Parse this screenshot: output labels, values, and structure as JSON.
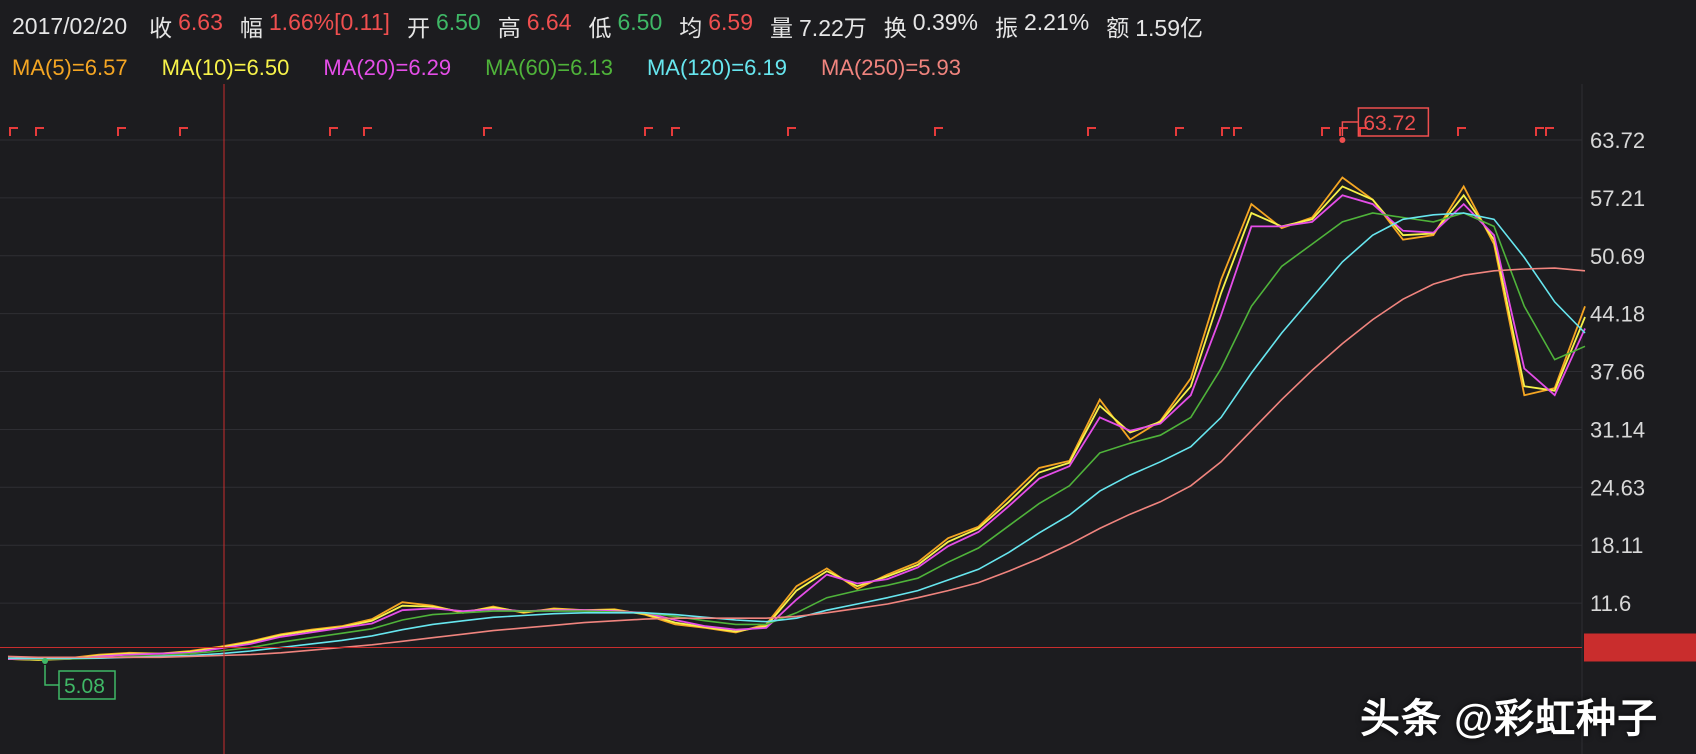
{
  "header": {
    "date": "2017/02/20",
    "items": [
      {
        "label": "收",
        "value": "6.63",
        "color": "red"
      },
      {
        "label": "幅",
        "value": "1.66%[0.11]",
        "color": "red"
      },
      {
        "label": "开",
        "value": "6.50",
        "color": "green"
      },
      {
        "label": "高",
        "value": "6.64",
        "color": "red"
      },
      {
        "label": "低",
        "value": "6.50",
        "color": "green"
      },
      {
        "label": "均",
        "value": "6.59",
        "color": "red"
      },
      {
        "label": "量",
        "value": "7.22万",
        "color": "white"
      },
      {
        "label": "换",
        "value": "0.39%",
        "color": "white"
      },
      {
        "label": "振",
        "value": "2.21%",
        "color": "white"
      },
      {
        "label": "额",
        "value": "1.59亿",
        "color": "white"
      }
    ]
  },
  "ma_legend": [
    {
      "text": "MA(5)=6.57",
      "color": "#f5a623"
    },
    {
      "text": "MA(10)=6.50",
      "color": "#f7f24a"
    },
    {
      "text": "MA(20)=6.29",
      "color": "#e54ee8"
    },
    {
      "text": "MA(60)=6.13",
      "color": "#4fb33a"
    },
    {
      "text": "MA(120)=6.19",
      "color": "#67e6ef"
    },
    {
      "text": "MA(250)=5.93",
      "color": "#f0847e"
    }
  ],
  "watermark": "头条 @彩虹种子",
  "chart_data": {
    "type": "line",
    "y_tick_labels": [
      "63.72",
      "57.21",
      "50.69",
      "44.18",
      "37.66",
      "31.14",
      "24.63",
      "18.11",
      "11.6"
    ],
    "ylim": [
      5.08,
      63.72
    ],
    "x": [
      0,
      30,
      60,
      90,
      120,
      150,
      180,
      210,
      240,
      270,
      300,
      330,
      360,
      390,
      420,
      450,
      480,
      510,
      540,
      570,
      600,
      630,
      660,
      690,
      720,
      750,
      780,
      810,
      840,
      870,
      900,
      930,
      960,
      990,
      1020,
      1050,
      1080,
      1110,
      1140,
      1170,
      1200,
      1230,
      1260,
      1290,
      1320,
      1350,
      1380,
      1410,
      1440,
      1470,
      1500,
      1530,
      1560
    ],
    "max_label": "63.72",
    "min_label": "5.08",
    "crosshair_price": "6.6",
    "series": [
      {
        "name": "MA(5)",
        "color": "#f5a623",
        "values": [
          5.3,
          5.2,
          5.4,
          5.8,
          6.0,
          5.9,
          6.2,
          6.7,
          7.3,
          8.1,
          8.6,
          9.0,
          9.8,
          11.7,
          11.3,
          10.5,
          11.2,
          10.5,
          11.0,
          10.8,
          10.9,
          10.3,
          9.2,
          8.8,
          8.3,
          9.2,
          13.5,
          15.5,
          13.2,
          14.8,
          16.2,
          18.9,
          20.2,
          23.5,
          26.8,
          27.6,
          34.5,
          30.0,
          32.1,
          36.9,
          48.0,
          56.5,
          53.8,
          55.0,
          59.5,
          57.0,
          52.5,
          53.0,
          58.5,
          52.0,
          35.0,
          35.8,
          45.0
        ]
      },
      {
        "name": "MA(10)",
        "color": "#f7f24a",
        "values": [
          5.3,
          5.2,
          5.3,
          5.7,
          5.9,
          5.9,
          6.1,
          6.6,
          7.2,
          8.0,
          8.5,
          8.9,
          9.6,
          11.3,
          11.2,
          10.6,
          11.1,
          10.6,
          10.9,
          10.8,
          10.8,
          10.4,
          9.4,
          8.9,
          8.4,
          9.0,
          13.0,
          15.2,
          13.5,
          14.6,
          15.9,
          18.5,
          20.0,
          23.0,
          26.3,
          27.4,
          33.8,
          30.8,
          32.0,
          36.0,
          46.5,
          55.5,
          54.0,
          54.8,
          58.5,
          57.0,
          53.0,
          53.2,
          57.5,
          52.5,
          36.0,
          35.5,
          43.8
        ]
      },
      {
        "name": "MA(20)",
        "color": "#e54ee8",
        "values": [
          5.3,
          5.3,
          5.3,
          5.6,
          5.8,
          5.9,
          6.0,
          6.5,
          7.0,
          7.8,
          8.3,
          8.8,
          9.3,
          10.8,
          11.0,
          10.7,
          10.9,
          10.7,
          10.8,
          10.8,
          10.7,
          10.5,
          9.7,
          9.0,
          8.6,
          8.8,
          12.0,
          14.8,
          13.8,
          14.3,
          15.6,
          18.0,
          19.6,
          22.5,
          25.6,
          27.0,
          32.5,
          31.0,
          31.8,
          35.0,
          44.0,
          54.0,
          54.0,
          54.5,
          57.5,
          56.5,
          53.5,
          53.3,
          56.5,
          53.0,
          38.0,
          35.0,
          42.5
        ]
      },
      {
        "name": "MA(60)",
        "color": "#4fb33a",
        "values": [
          5.4,
          5.3,
          5.3,
          5.4,
          5.6,
          5.7,
          5.9,
          6.2,
          6.6,
          7.2,
          7.7,
          8.2,
          8.7,
          9.7,
          10.3,
          10.5,
          10.7,
          10.7,
          10.7,
          10.7,
          10.6,
          10.5,
          10.1,
          9.6,
          9.2,
          9.2,
          10.5,
          12.2,
          13.0,
          13.6,
          14.4,
          16.2,
          17.8,
          20.3,
          22.8,
          24.8,
          28.5,
          29.6,
          30.5,
          32.5,
          38.0,
          45.0,
          49.5,
          52.0,
          54.5,
          55.5,
          55.0,
          54.5,
          55.5,
          54.0,
          45.0,
          39.0,
          40.5
        ]
      },
      {
        "name": "MA(120)",
        "color": "#67e6ef",
        "values": [
          5.4,
          5.4,
          5.4,
          5.4,
          5.5,
          5.6,
          5.7,
          5.9,
          6.2,
          6.6,
          7.0,
          7.4,
          7.9,
          8.6,
          9.2,
          9.6,
          10.0,
          10.2,
          10.4,
          10.5,
          10.5,
          10.5,
          10.3,
          10.0,
          9.7,
          9.5,
          9.9,
          10.8,
          11.5,
          12.2,
          13.0,
          14.2,
          15.4,
          17.3,
          19.5,
          21.5,
          24.2,
          26.0,
          27.5,
          29.2,
          32.5,
          37.5,
          42.0,
          46.0,
          50.0,
          53.0,
          54.8,
          55.3,
          55.5,
          54.8,
          50.5,
          45.5,
          42.0
        ]
      },
      {
        "name": "MA(250)",
        "color": "#f0847e",
        "values": [
          5.6,
          5.5,
          5.5,
          5.5,
          5.5,
          5.5,
          5.6,
          5.7,
          5.8,
          6.0,
          6.3,
          6.6,
          6.9,
          7.3,
          7.7,
          8.1,
          8.5,
          8.8,
          9.1,
          9.4,
          9.6,
          9.8,
          9.9,
          9.9,
          9.9,
          9.9,
          10.1,
          10.5,
          11.0,
          11.5,
          12.2,
          13.0,
          13.9,
          15.2,
          16.6,
          18.2,
          20.0,
          21.6,
          23.0,
          24.8,
          27.5,
          31.0,
          34.5,
          37.8,
          40.8,
          43.5,
          45.8,
          47.5,
          48.5,
          49.0,
          49.2,
          49.3,
          49.0
        ]
      }
    ]
  }
}
